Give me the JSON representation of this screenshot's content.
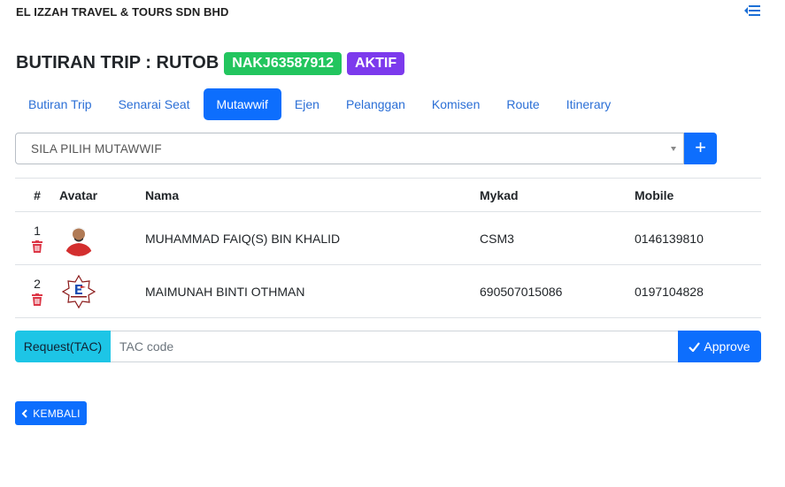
{
  "header": {
    "company": "EL IZZAH TRAVEL & TOURS SDN BHD",
    "menu_icon": "sidebar-collapse-icon"
  },
  "page": {
    "title": "BUTIRAN TRIP : RUTOB",
    "code_badge": "NAKJ63587912",
    "status_badge": "AKTIF",
    "colors": {
      "code_badge": "#22c55e",
      "status_badge": "#7c3aed",
      "primary": "#0d6efd",
      "info": "#1dc5e6",
      "danger": "#dc3545"
    }
  },
  "tabs": [
    {
      "label": "Butiran Trip"
    },
    {
      "label": "Senarai Seat"
    },
    {
      "label": "Mutawwif",
      "active": true
    },
    {
      "label": "Ejen"
    },
    {
      "label": "Pelanggan"
    },
    {
      "label": "Komisen"
    },
    {
      "label": "Route"
    },
    {
      "label": "Itinerary"
    }
  ],
  "mutawwif_select": {
    "selected": "SILA PILIH MUTAWWIF",
    "add_label": "+"
  },
  "table": {
    "columns": [
      "#",
      "Avatar",
      "Nama",
      "Mykad",
      "Mobile"
    ],
    "rows": [
      {
        "no": "1",
        "avatar": "person-photo",
        "nama": "MUHAMMAD FAIQ(S) BIN KHALID",
        "mykad": "CSM3",
        "mobile": "0146139810"
      },
      {
        "no": "2",
        "avatar": "el-izzah-logo",
        "nama": "MAIMUNAH BINTI OTHMAN",
        "mykad": "690507015086",
        "mobile": "0197104828"
      }
    ]
  },
  "tac": {
    "request_label": "Request(TAC)",
    "placeholder": "TAC code",
    "value": "",
    "approve_label": "Approve"
  },
  "back_button": {
    "label": "KEMBALI"
  }
}
